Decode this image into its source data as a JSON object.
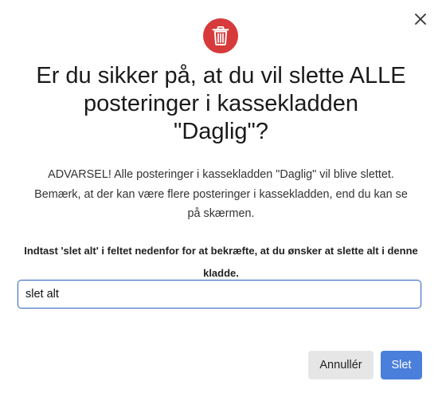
{
  "dialog": {
    "close_icon": "close-icon",
    "header_icon": "trash-icon",
    "header_icon_color": "#d63a3a",
    "title": "Er du sikker på, at du vil slette ALLE\nposteringer i kassekladden\n\"Daglig\"?",
    "warning_line1": "ADVARSEL! Alle posteringer i kassekladden \"Daglig\" vil blive slettet.",
    "warning_line2": "Bemærk, at der kan være flere posteringer i kassekladden, end du kan se",
    "warning_line3": "på skærmen.",
    "instruction": "Indtast 'slet alt' i feltet nedenfor for at bekræfte, at du ønsker at slette alt i denne kladde.",
    "confirm_input_value": "slet alt",
    "cancel_label": "Annullér",
    "delete_label": "Slet",
    "accent_color": "#4a7fdb"
  }
}
